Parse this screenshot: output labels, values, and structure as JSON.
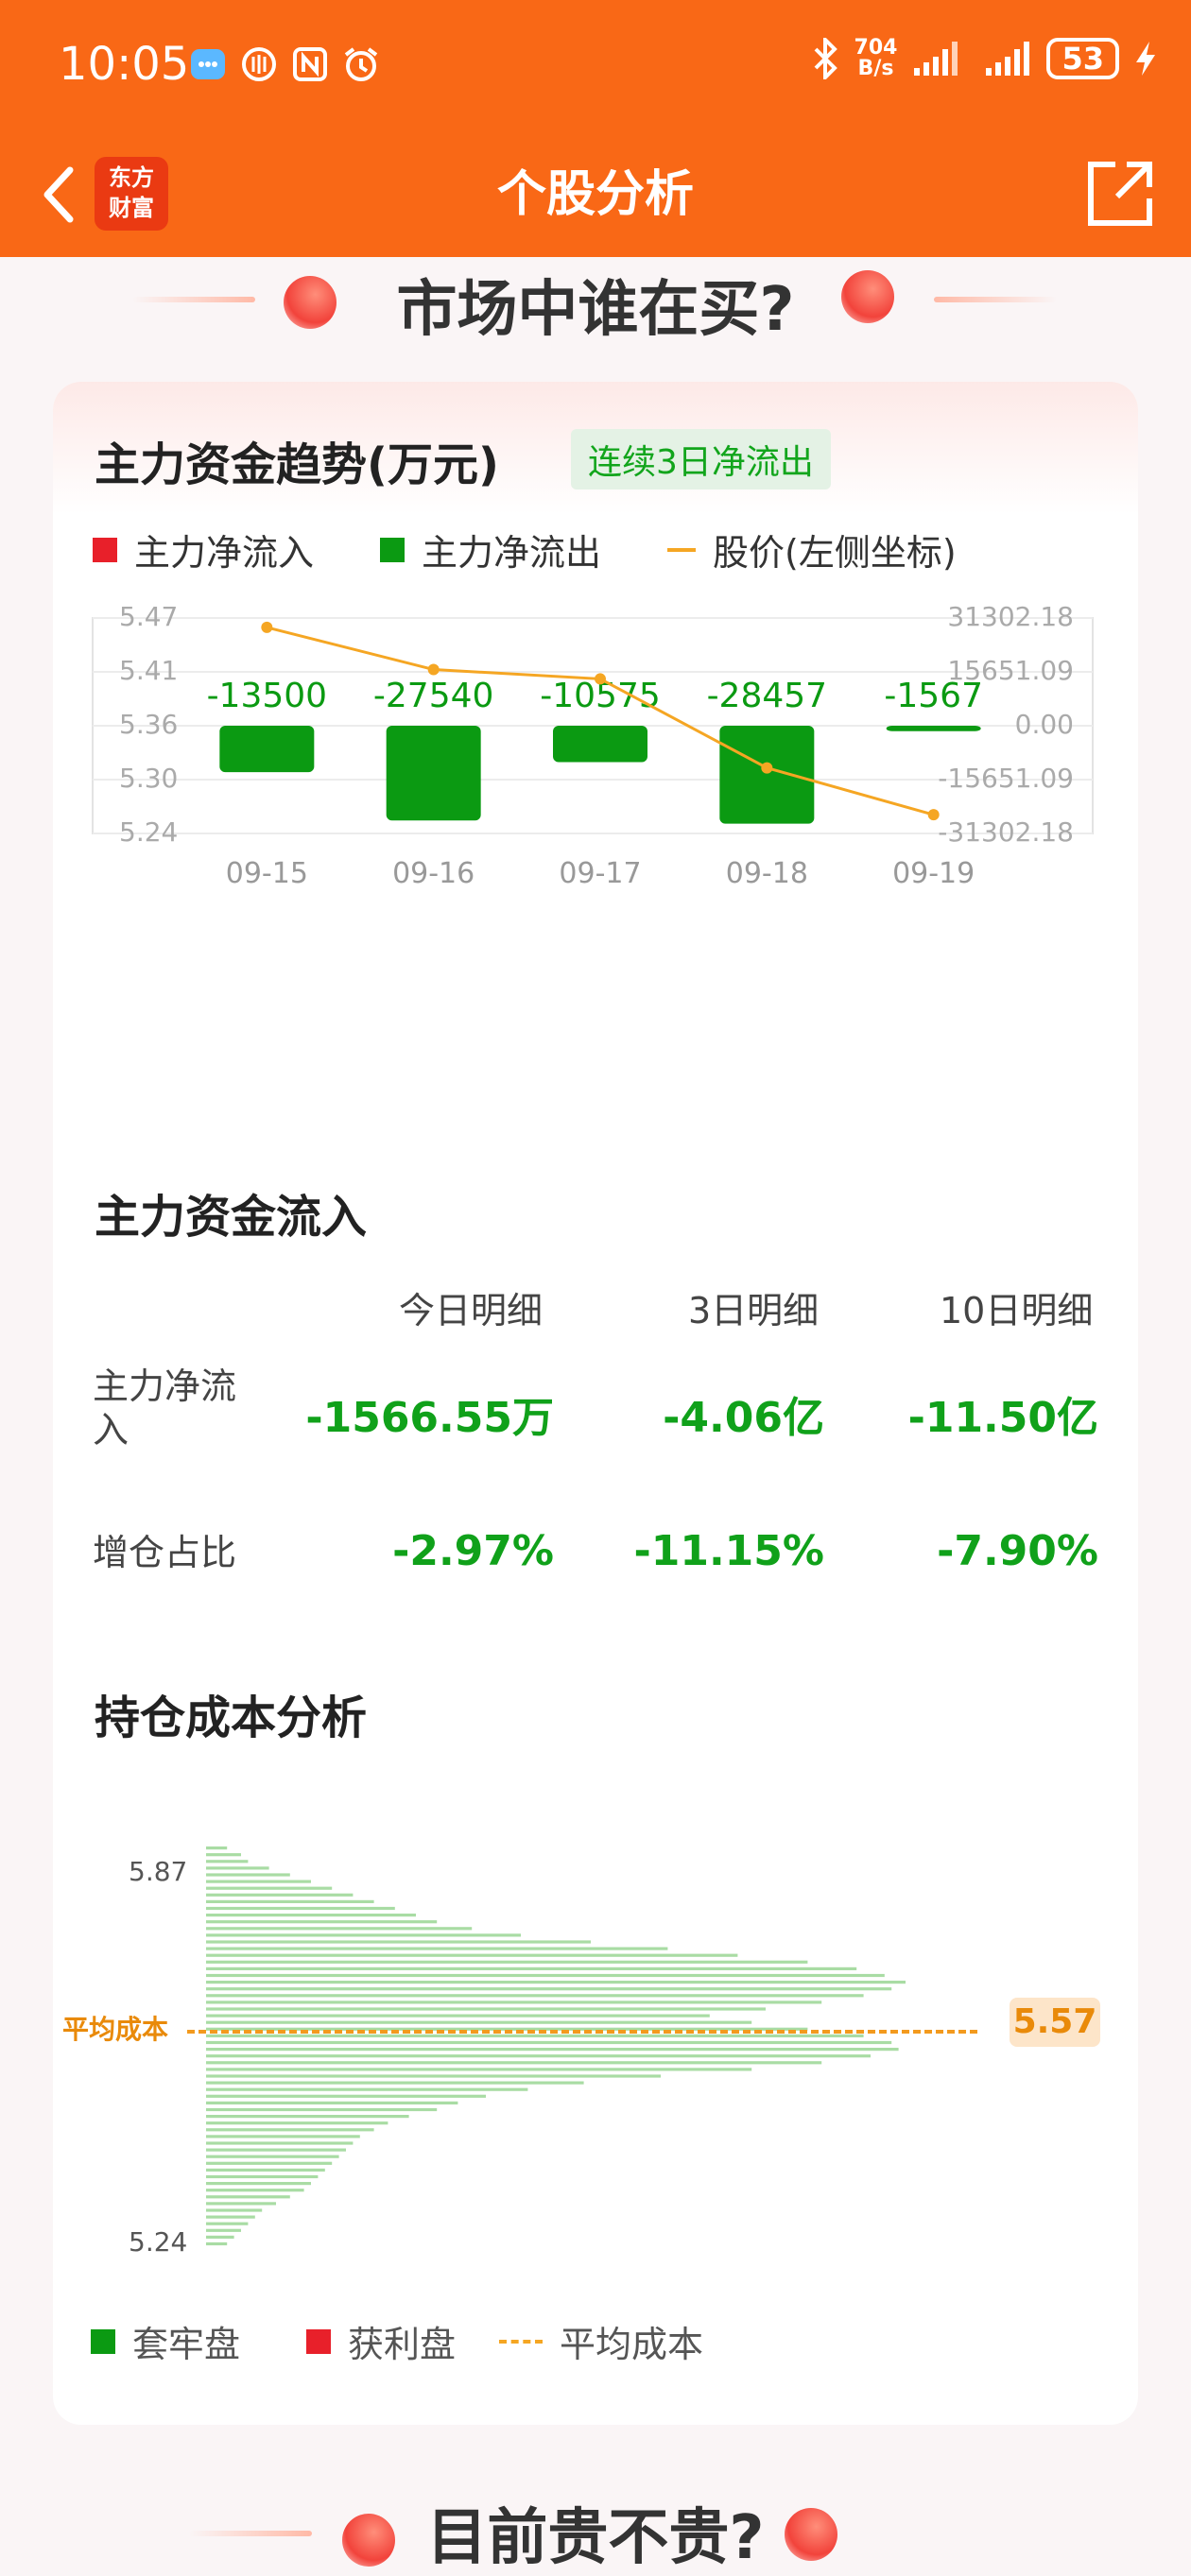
{
  "status_bar": {
    "time": "10:05",
    "speed_top": "704",
    "speed_bottom": "B/s",
    "battery": "53"
  },
  "header": {
    "title": "个股分析",
    "logo_line1": "东方",
    "logo_line2": "财富"
  },
  "section1": {
    "title": "市场中谁在买?"
  },
  "section2": {
    "title": "目前贵不贵?"
  },
  "trend": {
    "title": "主力资金趋势(万元)",
    "tag": "连续3日净流出",
    "legend": {
      "inflow": "主力净流入",
      "outflow": "主力净流出",
      "price": "股价(左侧坐标)"
    },
    "colors": {
      "inflow": "#e8202a",
      "outflow": "#0b9a12",
      "price": "#f5a623"
    }
  },
  "chart_data": [
    {
      "type": "bar",
      "title": "主力资金趋势(万元)",
      "categories": [
        "09-15",
        "09-16",
        "09-17",
        "09-18",
        "09-19"
      ],
      "series": [
        {
          "name": "主力净流出",
          "values": [
            -13500,
            -27540,
            -10575,
            -28457,
            -1567
          ]
        },
        {
          "name": "股价(左侧坐标)",
          "type": "line",
          "values": [
            5.46,
            5.415,
            5.405,
            5.31,
            5.26
          ]
        }
      ],
      "bar_labels": [
        "-13500",
        "-27540",
        "-10575",
        "-28457",
        "-1567"
      ],
      "left_ticks": [
        "5.47",
        "5.41",
        "5.36",
        "5.30",
        "5.24"
      ],
      "right_ticks": [
        "31302.18",
        "15651.09",
        "0.00",
        "-15651.09",
        "-31302.18"
      ],
      "ylim_left": [
        5.24,
        5.47
      ],
      "ylim_right": [
        -31302.18,
        31302.18
      ],
      "grid": true,
      "legend": "top-left"
    },
    {
      "type": "bar",
      "title": "持仓成本分析",
      "orientation": "horizontal",
      "ylim": [
        5.24,
        5.87
      ],
      "y_ticks": [
        "5.87",
        "5.24"
      ],
      "values": [
        0.03,
        0.05,
        0.06,
        0.09,
        0.12,
        0.15,
        0.18,
        0.21,
        0.24,
        0.27,
        0.3,
        0.33,
        0.38,
        0.45,
        0.55,
        0.66,
        0.76,
        0.86,
        0.93,
        0.97,
        1.0,
        0.98,
        0.94,
        0.88,
        0.8,
        0.72,
        0.78,
        0.86,
        0.94,
        0.98,
        0.99,
        0.95,
        0.88,
        0.78,
        0.65,
        0.54,
        0.46,
        0.4,
        0.36,
        0.33,
        0.29,
        0.26,
        0.24,
        0.22,
        0.21,
        0.2,
        0.19,
        0.18,
        0.17,
        0.16,
        0.15,
        0.14,
        0.12,
        0.1,
        0.08,
        0.07,
        0.06,
        0.05,
        0.04,
        0.03
      ],
      "avg_cost": 5.57
    }
  ],
  "inflow": {
    "title": "主力资金流入",
    "headers": [
      "今日明细",
      "3日明细",
      "10日明细"
    ],
    "rows": [
      {
        "label": "主力净流入",
        "values": [
          "-1566.55万",
          "-4.06亿",
          "-11.50亿"
        ]
      },
      {
        "label": "增仓占比",
        "values": [
          "-2.97%",
          "-11.15%",
          "-7.90%"
        ]
      }
    ]
  },
  "cost": {
    "title": "持仓成本分析",
    "avg_label": "平均成本",
    "avg_value": "5.57",
    "legend": {
      "trapped": "套牢盘",
      "profit": "获利盘",
      "avg": "平均成本"
    },
    "colors": {
      "trapped": "#0b9a12",
      "profit": "#e8202a",
      "avg": "#f5a623"
    }
  }
}
